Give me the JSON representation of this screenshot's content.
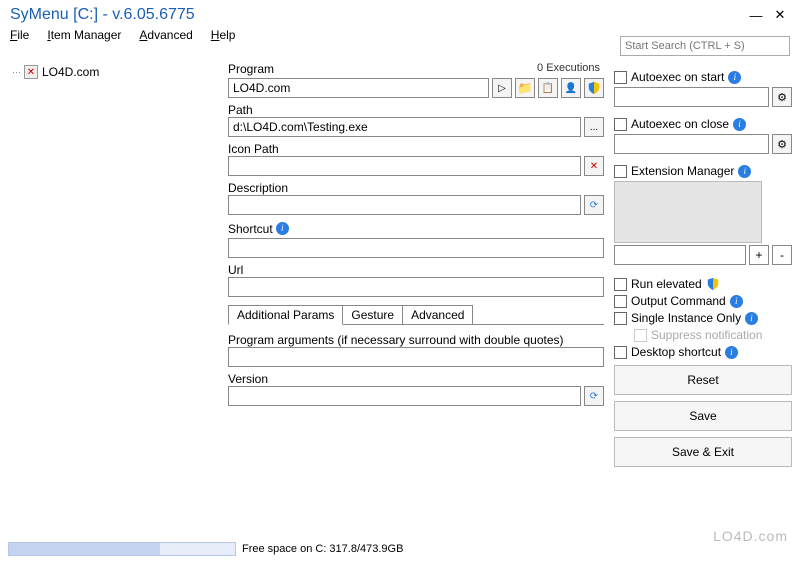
{
  "window": {
    "title": "SyMenu [C:] - v.6.05.6775"
  },
  "menu": {
    "file": "File",
    "item_manager": "Item Manager",
    "advanced": "Advanced",
    "help": "Help"
  },
  "search": {
    "placeholder": "Start Search (CTRL + S)"
  },
  "tree": {
    "item0": "LO4D.com"
  },
  "form": {
    "program_label": "Program",
    "executions": "0 Executions",
    "program_value": "LO4D.com",
    "path_label": "Path",
    "path_value": "d:\\LO4D.com\\Testing.exe",
    "browse_dots": "...",
    "icon_path_label": "Icon Path",
    "icon_path_value": "",
    "description_label": "Description",
    "description_value": "",
    "shortcut_label": "Shortcut",
    "shortcut_value": "",
    "url_label": "Url",
    "url_value": "",
    "tabs": {
      "additional": "Additional Params",
      "gesture": "Gesture",
      "advanced": "Advanced"
    },
    "args_label": "Program arguments (if necessary surround with double quotes)",
    "args_value": "",
    "version_label": "Version",
    "version_value": ""
  },
  "right": {
    "autoexec_start": "Autoexec on start",
    "autoexec_close": "Autoexec on close",
    "ext_manager": "Extension Manager",
    "plus": "+",
    "minus": "-",
    "run_elevated": "Run elevated",
    "output_command": "Output Command",
    "single_instance": "Single Instance Only",
    "suppress": "Suppress notification",
    "desktop_shortcut": "Desktop shortcut",
    "reset": "Reset",
    "save": "Save",
    "save_exit": "Save & Exit"
  },
  "status": {
    "text": "Free space on C: 317.8/473.9GB"
  },
  "watermark": "LO4D.com"
}
